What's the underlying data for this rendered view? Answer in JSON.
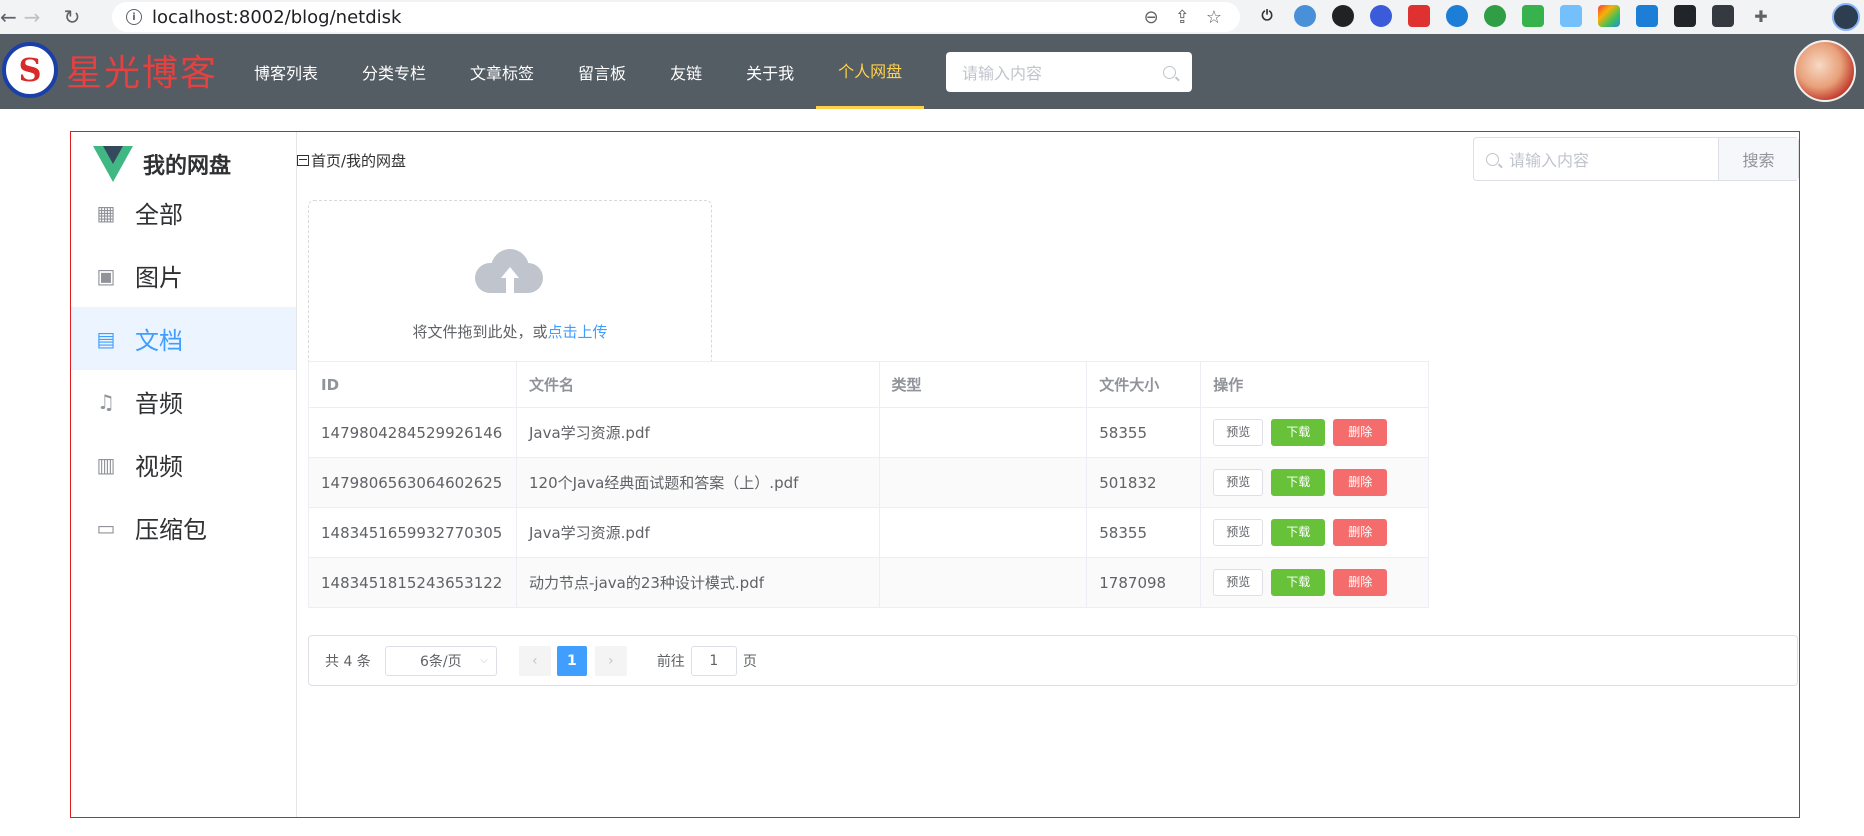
{
  "browser": {
    "url": "localhost:8002/blog/netdisk",
    "back": "←",
    "forward": "→",
    "reload": "↻",
    "info": "i",
    "zoom": "⊖",
    "share": "⇪",
    "star": "☆"
  },
  "header": {
    "logo_mark": "S",
    "logo_text": "星光博客",
    "menu": [
      "博客列表",
      "分类专栏",
      "文章标签",
      "留言板",
      "友链",
      "关于我",
      "个人网盘"
    ],
    "search_placeholder": "请输入内容"
  },
  "sidebar": {
    "title": "我的网盘",
    "items": [
      {
        "label": "全部",
        "icon": "grid-icon",
        "glyph": "▦"
      },
      {
        "label": "图片",
        "icon": "image-icon",
        "glyph": "▣"
      },
      {
        "label": "文档",
        "icon": "document-icon",
        "glyph": "▤"
      },
      {
        "label": "音频",
        "icon": "headphones-icon",
        "glyph": "♫"
      },
      {
        "label": "视频",
        "icon": "film-icon",
        "glyph": "▥"
      },
      {
        "label": "压缩包",
        "icon": "briefcase-icon",
        "glyph": "▭"
      }
    ]
  },
  "breadcrumb": "首页/我的网盘",
  "search": {
    "placeholder": "请输入内容",
    "button": "搜索"
  },
  "upload": {
    "text": "将文件拖到此处，或",
    "link": "点击上传"
  },
  "table": {
    "headers": [
      "ID",
      "文件名",
      "类型",
      "文件大小",
      "操作"
    ],
    "rows": [
      {
        "id": "1479804284529926146",
        "name": "Java学习资源.pdf",
        "type": "",
        "size": "58355"
      },
      {
        "id": "1479806563064602625",
        "name": "120个Java经典面试题和答案（上）.pdf",
        "type": "",
        "size": "501832"
      },
      {
        "id": "1483451659932770305",
        "name": "Java学习资源.pdf",
        "type": "",
        "size": "58355"
      },
      {
        "id": "1483451815243653122",
        "name": "动力节点-java的23种设计模式.pdf",
        "type": "",
        "size": "1787098"
      }
    ],
    "actions": {
      "preview": "预览",
      "download": "下载",
      "delete": "删除"
    }
  },
  "pagination": {
    "total": "共 4 条",
    "page_size": "6条/页",
    "prev": "‹",
    "next": "›",
    "current": "1",
    "goto_prefix": "前往",
    "goto_value": "1",
    "goto_suffix": "页"
  },
  "colors": {
    "active_menu": "#ffd04b",
    "header_bg": "#545c64",
    "primary": "#409eff",
    "success": "#67c23a",
    "danger": "#f56c6c",
    "frame_border": "#e01e1e"
  }
}
